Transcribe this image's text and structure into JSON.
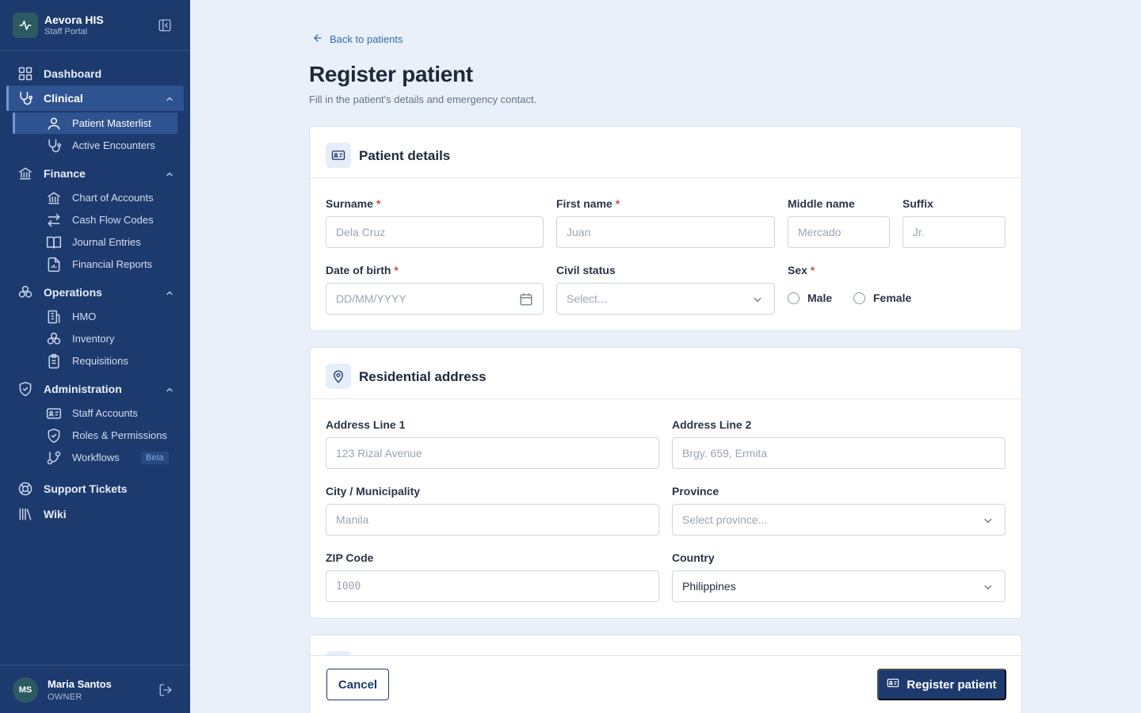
{
  "app": {
    "name": "Aevora HIS",
    "subtitle": "Staff Portal"
  },
  "sidebar": {
    "groups": [
      {
        "label": "Dashboard",
        "icon": "dashboard-icon"
      },
      {
        "label": "Clinical",
        "icon": "stethoscope-icon",
        "expanded": true,
        "active": true,
        "items": [
          {
            "label": "Patient Masterlist",
            "icon": "user-icon",
            "active": true
          },
          {
            "label": "Active Encounters",
            "icon": "stethoscope-icon"
          }
        ]
      },
      {
        "label": "Finance",
        "icon": "bank-icon",
        "expanded": true,
        "items": [
          {
            "label": "Chart of Accounts",
            "icon": "bank-icon"
          },
          {
            "label": "Cash Flow Codes",
            "icon": "arrows-exchange-icon"
          },
          {
            "label": "Journal Entries",
            "icon": "book-icon"
          },
          {
            "label": "Financial Reports",
            "icon": "report-icon"
          }
        ]
      },
      {
        "label": "Operations",
        "icon": "boxes-icon",
        "expanded": true,
        "items": [
          {
            "label": "HMO",
            "icon": "building-icon"
          },
          {
            "label": "Inventory",
            "icon": "boxes-icon"
          },
          {
            "label": "Requisitions",
            "icon": "clipboard-icon"
          }
        ]
      },
      {
        "label": "Administration",
        "icon": "shield-icon",
        "expanded": true,
        "items": [
          {
            "label": "Staff Accounts",
            "icon": "id-card-icon"
          },
          {
            "label": "Roles & Permissions",
            "icon": "shield-icon"
          },
          {
            "label": "Workflows",
            "icon": "git-branch-icon",
            "badge": "Beta"
          }
        ]
      },
      {
        "label": "Support Tickets",
        "icon": "lifebuoy-icon"
      },
      {
        "label": "Wiki",
        "icon": "library-icon"
      }
    ]
  },
  "user": {
    "initials": "MS",
    "name": "Maria Santos",
    "role": "OWNER"
  },
  "page": {
    "back_label": "Back to patients",
    "title": "Register patient",
    "subtitle": "Fill in the patient's details and emergency contact."
  },
  "patient_details": {
    "title": "Patient details",
    "surname": {
      "label": "Surname",
      "placeholder": "Dela Cruz",
      "required": "*"
    },
    "first_name": {
      "label": "First name",
      "placeholder": "Juan",
      "required": "*"
    },
    "middle_name": {
      "label": "Middle name",
      "placeholder": "Mercado"
    },
    "suffix": {
      "label": "Suffix",
      "placeholder": "Jr."
    },
    "dob": {
      "label": "Date of birth",
      "placeholder": "DD/MM/YYYY",
      "required": "*"
    },
    "civil_status": {
      "label": "Civil status",
      "placeholder": "Select..."
    },
    "sex": {
      "label": "Sex",
      "required": "*",
      "options": [
        "Male",
        "Female"
      ]
    }
  },
  "address": {
    "title": "Residential address",
    "line1": {
      "label": "Address Line 1",
      "placeholder": "123 Rizal Avenue"
    },
    "line2": {
      "label": "Address Line 2",
      "placeholder": "Brgy. 659, Ermita"
    },
    "city": {
      "label": "City / Municipality",
      "placeholder": "Manila"
    },
    "province": {
      "label": "Province",
      "placeholder": "Select province..."
    },
    "zip": {
      "label": "ZIP Code",
      "placeholder": "1000"
    },
    "country": {
      "label": "Country",
      "value": "Philippines"
    }
  },
  "actions": {
    "cancel": "Cancel",
    "submit": "Register patient"
  },
  "colors": {
    "sidebar": "#1d3a6e",
    "accent": "#3568b5",
    "required": "#d94848",
    "background": "#e9f0fa"
  }
}
